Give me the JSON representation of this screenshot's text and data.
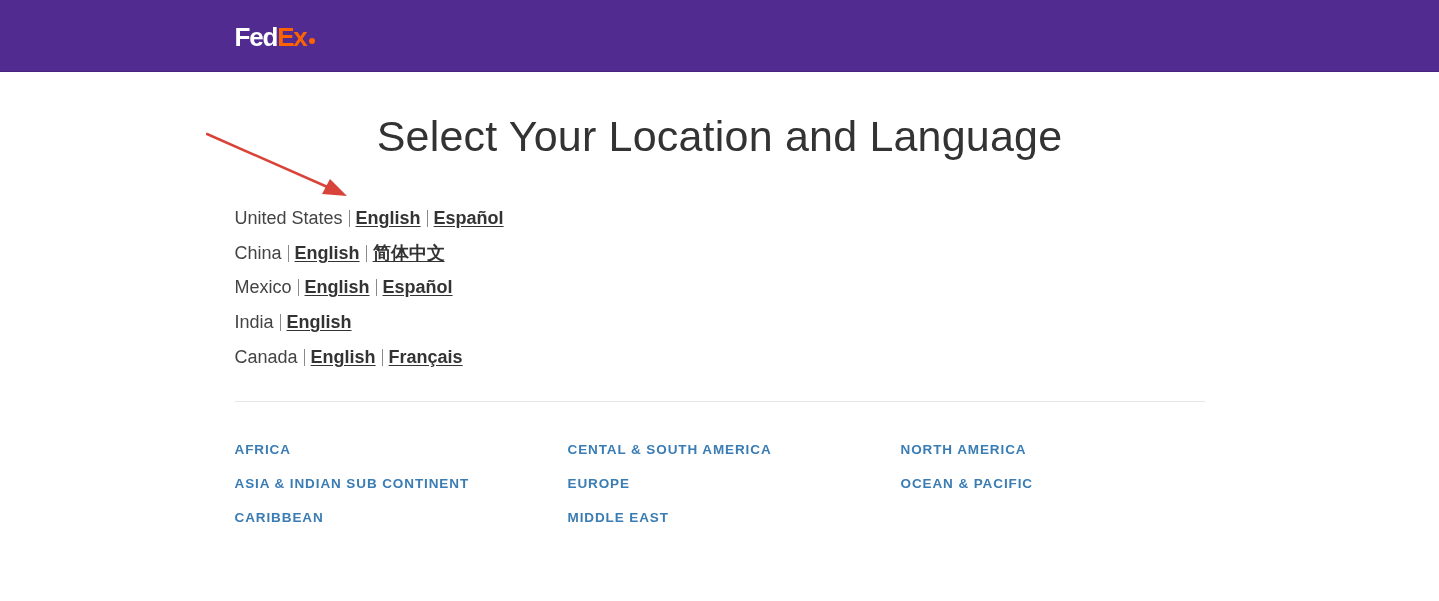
{
  "header": {
    "logo": [
      {
        "text": "Fed",
        "color": "#ffffff"
      },
      {
        "text": "Ex",
        "color": "#ff6200"
      }
    ]
  },
  "title": "Select Your Location and Language",
  "locations": [
    {
      "country": "United States",
      "languages": [
        "English",
        "Español"
      ]
    },
    {
      "country": "China",
      "languages": [
        "English",
        "简体中文"
      ]
    },
    {
      "country": "Mexico",
      "languages": [
        "English",
        "Español"
      ]
    },
    {
      "country": "India",
      "languages": [
        "English"
      ]
    },
    {
      "country": "Canada",
      "languages": [
        "English",
        "Français"
      ]
    }
  ],
  "regions": {
    "columns": [
      [
        "AFRICA",
        "ASIA & INDIAN SUB CONTINENT",
        "CARIBBEAN"
      ],
      [
        "CENTAL & SOUTH AMERICA",
        "EUROPE",
        "MIDDLE EAST"
      ],
      [
        "NORTH AMERICA",
        "OCEAN & PACIFIC"
      ]
    ]
  }
}
